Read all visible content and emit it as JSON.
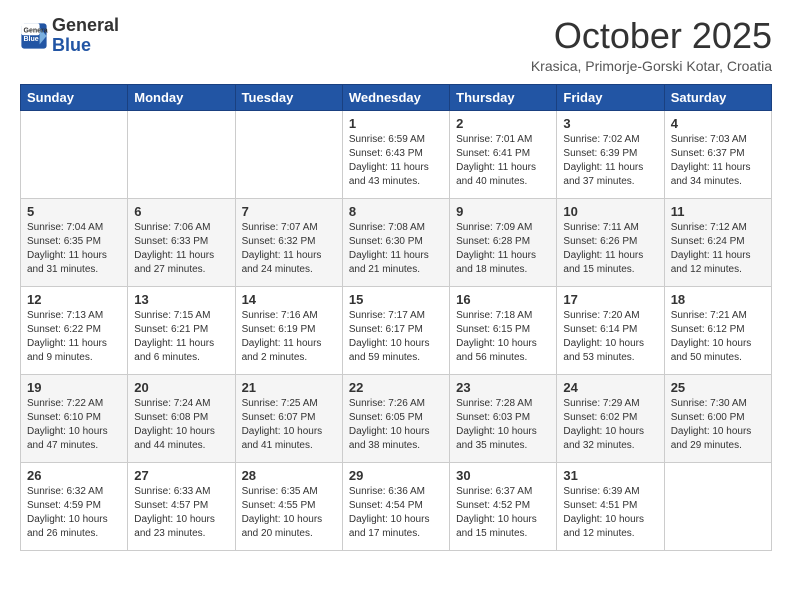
{
  "logo": {
    "general": "General",
    "blue": "Blue"
  },
  "header": {
    "month": "October 2025",
    "location": "Krasica, Primorje-Gorski Kotar, Croatia"
  },
  "weekdays": [
    "Sunday",
    "Monday",
    "Tuesday",
    "Wednesday",
    "Thursday",
    "Friday",
    "Saturday"
  ],
  "weeks": [
    [
      {
        "day": "",
        "info": ""
      },
      {
        "day": "",
        "info": ""
      },
      {
        "day": "",
        "info": ""
      },
      {
        "day": "1",
        "info": "Sunrise: 6:59 AM\nSunset: 6:43 PM\nDaylight: 11 hours\nand 43 minutes."
      },
      {
        "day": "2",
        "info": "Sunrise: 7:01 AM\nSunset: 6:41 PM\nDaylight: 11 hours\nand 40 minutes."
      },
      {
        "day": "3",
        "info": "Sunrise: 7:02 AM\nSunset: 6:39 PM\nDaylight: 11 hours\nand 37 minutes."
      },
      {
        "day": "4",
        "info": "Sunrise: 7:03 AM\nSunset: 6:37 PM\nDaylight: 11 hours\nand 34 minutes."
      }
    ],
    [
      {
        "day": "5",
        "info": "Sunrise: 7:04 AM\nSunset: 6:35 PM\nDaylight: 11 hours\nand 31 minutes."
      },
      {
        "day": "6",
        "info": "Sunrise: 7:06 AM\nSunset: 6:33 PM\nDaylight: 11 hours\nand 27 minutes."
      },
      {
        "day": "7",
        "info": "Sunrise: 7:07 AM\nSunset: 6:32 PM\nDaylight: 11 hours\nand 24 minutes."
      },
      {
        "day": "8",
        "info": "Sunrise: 7:08 AM\nSunset: 6:30 PM\nDaylight: 11 hours\nand 21 minutes."
      },
      {
        "day": "9",
        "info": "Sunrise: 7:09 AM\nSunset: 6:28 PM\nDaylight: 11 hours\nand 18 minutes."
      },
      {
        "day": "10",
        "info": "Sunrise: 7:11 AM\nSunset: 6:26 PM\nDaylight: 11 hours\nand 15 minutes."
      },
      {
        "day": "11",
        "info": "Sunrise: 7:12 AM\nSunset: 6:24 PM\nDaylight: 11 hours\nand 12 minutes."
      }
    ],
    [
      {
        "day": "12",
        "info": "Sunrise: 7:13 AM\nSunset: 6:22 PM\nDaylight: 11 hours\nand 9 minutes."
      },
      {
        "day": "13",
        "info": "Sunrise: 7:15 AM\nSunset: 6:21 PM\nDaylight: 11 hours\nand 6 minutes."
      },
      {
        "day": "14",
        "info": "Sunrise: 7:16 AM\nSunset: 6:19 PM\nDaylight: 11 hours\nand 2 minutes."
      },
      {
        "day": "15",
        "info": "Sunrise: 7:17 AM\nSunset: 6:17 PM\nDaylight: 10 hours\nand 59 minutes."
      },
      {
        "day": "16",
        "info": "Sunrise: 7:18 AM\nSunset: 6:15 PM\nDaylight: 10 hours\nand 56 minutes."
      },
      {
        "day": "17",
        "info": "Sunrise: 7:20 AM\nSunset: 6:14 PM\nDaylight: 10 hours\nand 53 minutes."
      },
      {
        "day": "18",
        "info": "Sunrise: 7:21 AM\nSunset: 6:12 PM\nDaylight: 10 hours\nand 50 minutes."
      }
    ],
    [
      {
        "day": "19",
        "info": "Sunrise: 7:22 AM\nSunset: 6:10 PM\nDaylight: 10 hours\nand 47 minutes."
      },
      {
        "day": "20",
        "info": "Sunrise: 7:24 AM\nSunset: 6:08 PM\nDaylight: 10 hours\nand 44 minutes."
      },
      {
        "day": "21",
        "info": "Sunrise: 7:25 AM\nSunset: 6:07 PM\nDaylight: 10 hours\nand 41 minutes."
      },
      {
        "day": "22",
        "info": "Sunrise: 7:26 AM\nSunset: 6:05 PM\nDaylight: 10 hours\nand 38 minutes."
      },
      {
        "day": "23",
        "info": "Sunrise: 7:28 AM\nSunset: 6:03 PM\nDaylight: 10 hours\nand 35 minutes."
      },
      {
        "day": "24",
        "info": "Sunrise: 7:29 AM\nSunset: 6:02 PM\nDaylight: 10 hours\nand 32 minutes."
      },
      {
        "day": "25",
        "info": "Sunrise: 7:30 AM\nSunset: 6:00 PM\nDaylight: 10 hours\nand 29 minutes."
      }
    ],
    [
      {
        "day": "26",
        "info": "Sunrise: 6:32 AM\nSunset: 4:59 PM\nDaylight: 10 hours\nand 26 minutes."
      },
      {
        "day": "27",
        "info": "Sunrise: 6:33 AM\nSunset: 4:57 PM\nDaylight: 10 hours\nand 23 minutes."
      },
      {
        "day": "28",
        "info": "Sunrise: 6:35 AM\nSunset: 4:55 PM\nDaylight: 10 hours\nand 20 minutes."
      },
      {
        "day": "29",
        "info": "Sunrise: 6:36 AM\nSunset: 4:54 PM\nDaylight: 10 hours\nand 17 minutes."
      },
      {
        "day": "30",
        "info": "Sunrise: 6:37 AM\nSunset: 4:52 PM\nDaylight: 10 hours\nand 15 minutes."
      },
      {
        "day": "31",
        "info": "Sunrise: 6:39 AM\nSunset: 4:51 PM\nDaylight: 10 hours\nand 12 minutes."
      },
      {
        "day": "",
        "info": ""
      }
    ]
  ]
}
